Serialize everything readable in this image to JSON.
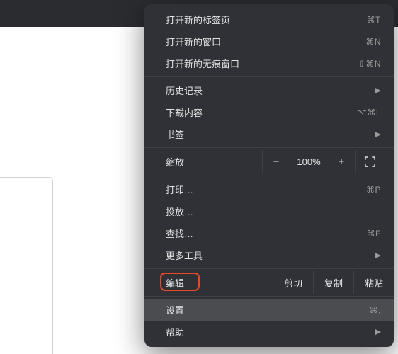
{
  "menu": {
    "new_tab": {
      "label": "打开新的标签页",
      "shortcut": "⌘T"
    },
    "new_window": {
      "label": "打开新的窗口",
      "shortcut": "⌘N"
    },
    "incognito": {
      "label": "打开新的无痕窗口",
      "shortcut": "⇧⌘N"
    },
    "history": {
      "label": "历史记录"
    },
    "downloads": {
      "label": "下载内容",
      "shortcut": "⌥⌘L"
    },
    "bookmarks": {
      "label": "书签"
    },
    "zoom": {
      "label": "缩放",
      "value": "100%"
    },
    "print": {
      "label": "打印…",
      "shortcut": "⌘P"
    },
    "cast": {
      "label": "投放…"
    },
    "find": {
      "label": "查找…",
      "shortcut": "⌘F"
    },
    "more_tools": {
      "label": "更多工具"
    },
    "edit": {
      "label": "编辑",
      "cut": "剪切",
      "copy": "复制",
      "paste": "粘贴"
    },
    "settings": {
      "label": "设置",
      "shortcut": "⌘,"
    },
    "help": {
      "label": "帮助"
    }
  }
}
